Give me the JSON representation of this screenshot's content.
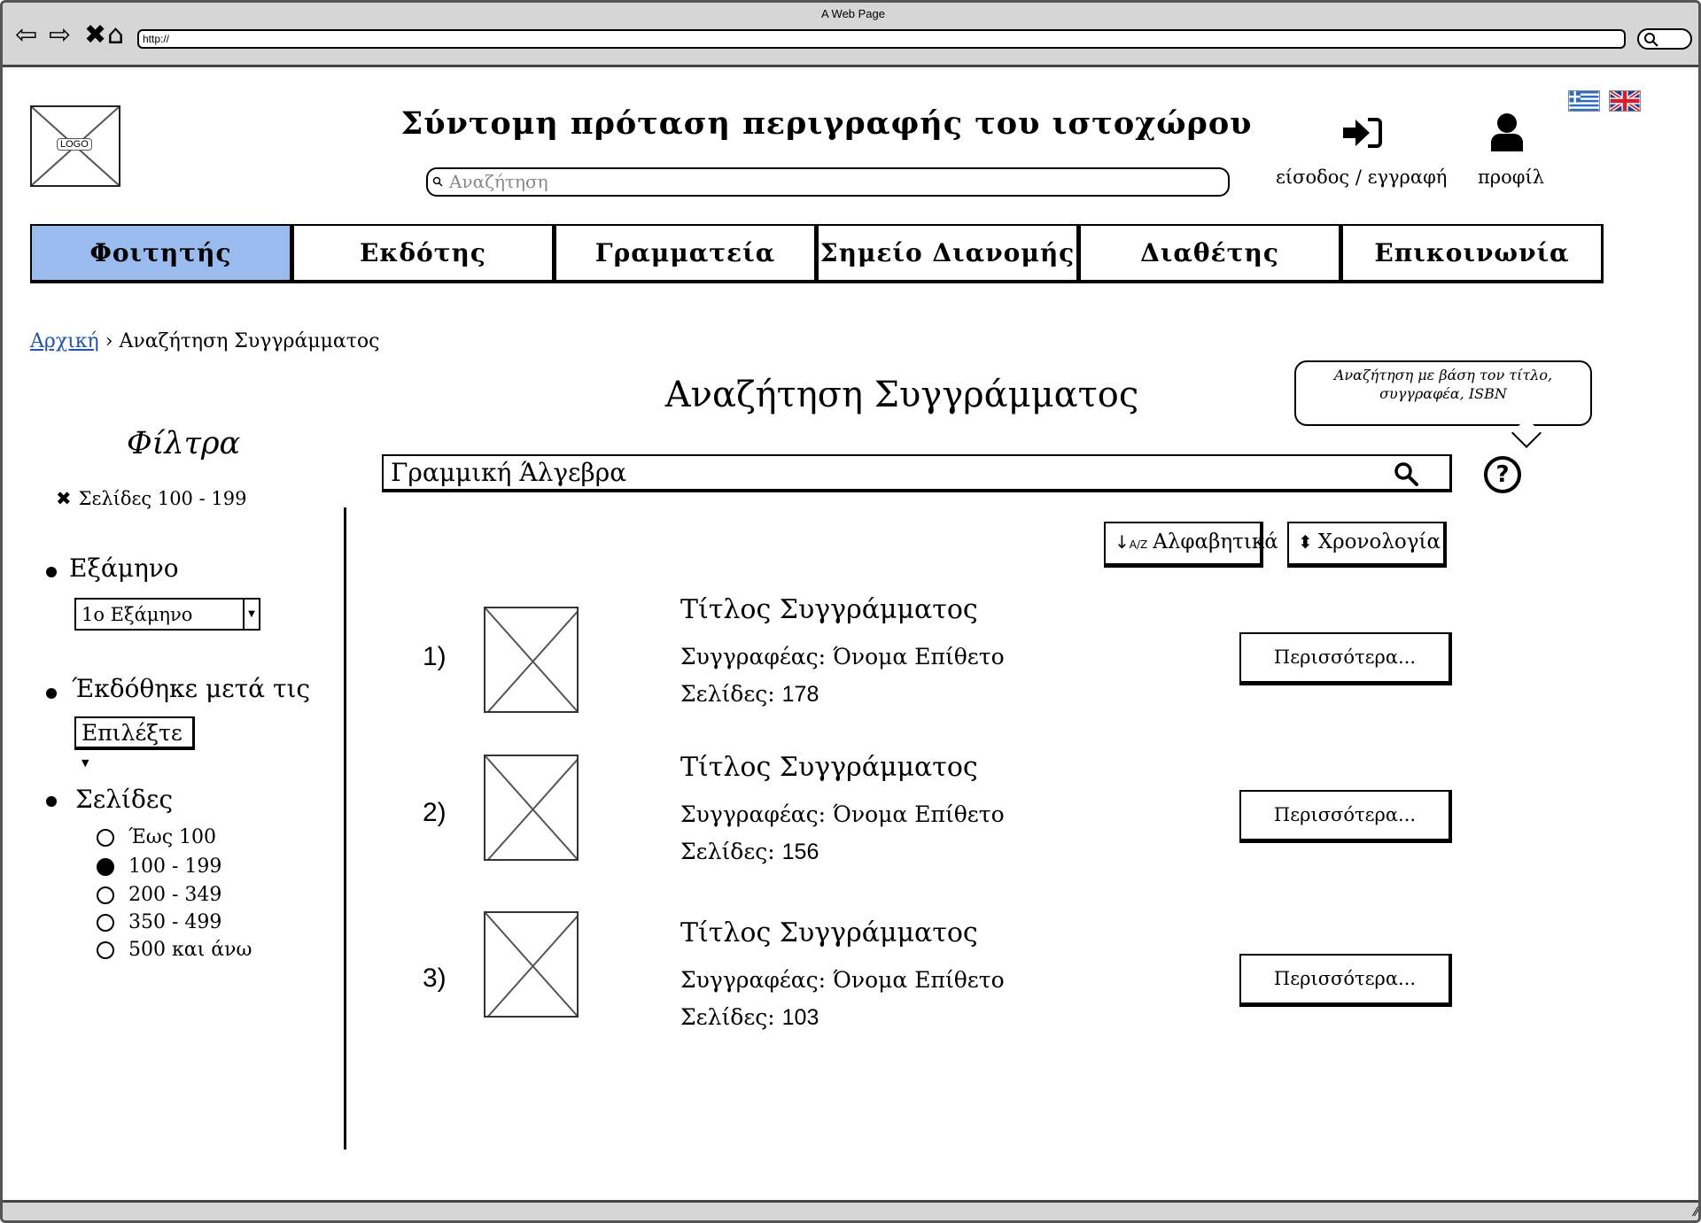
{
  "browser": {
    "window_title": "A Web Page",
    "url": "http://"
  },
  "header": {
    "logo_label": "LOGO",
    "site_description": "Σύντομη πρόταση περιγραφής του ιστοχώρου",
    "search_placeholder": "Αναζήτηση",
    "login_label": "είσοδος / εγγραφή",
    "profile_label": "προφίλ",
    "flags": [
      "greek-flag-icon",
      "uk-flag-icon"
    ]
  },
  "menu": {
    "items": [
      {
        "label": "Φοιτητής",
        "active": true
      },
      {
        "label": "Εκδότης",
        "active": false
      },
      {
        "label": "Γραμματεία",
        "active": false
      },
      {
        "label": "Σημείο Διανομής",
        "active": false
      },
      {
        "label": "Διαθέτης",
        "active": false
      },
      {
        "label": "Επικοινωνία",
        "active": false
      }
    ],
    "active_color": "#99bbee"
  },
  "breadcrumb": {
    "home": "Αρχική",
    "separator": "›",
    "current": "Αναζήτηση Συγγράμματος"
  },
  "filters": {
    "title": "Φίλτρα",
    "active_filter": "Σελίδες 100 - 199",
    "semester": {
      "label": "Εξάμηνο",
      "selected": "1ο Εξάμηνο"
    },
    "published_after": {
      "label": "Έκδόθηκε μετά τις",
      "button": "Επιλέξτε"
    },
    "pages": {
      "label": "Σελίδες",
      "options": [
        {
          "label": "Έως 100",
          "selected": false
        },
        {
          "label": "100 - 199",
          "selected": true
        },
        {
          "label": "200 - 349",
          "selected": false
        },
        {
          "label": "350 - 499",
          "selected": false
        },
        {
          "label": "500 και άνω",
          "selected": false
        }
      ]
    }
  },
  "main": {
    "title": "Αναζήτηση Συγγράμματος",
    "tooltip": "Αναζήτηση με βάση τον τίτλο, συγγραφέα, ISBN",
    "search_value": "Γραμμική Άλγεβρα",
    "sort": {
      "alphabetical": "Αλφαβητικά",
      "chronological": "Χρονολογία"
    },
    "results": [
      {
        "num": "1)",
        "title": "Τίτλος Συγγράμματος",
        "author": "Συγγραφέας: Όνομα Επίθετο",
        "pages_label": "Σελίδες:",
        "pages": "178",
        "more": "Περισσότερα..."
      },
      {
        "num": "2)",
        "title": "Τίτλος Συγγράμματος",
        "author": "Συγγραφέας: Όνομα Επίθετο",
        "pages_label": "Σελίδες:",
        "pages": "156",
        "more": "Περισσότερα..."
      },
      {
        "num": "3)",
        "title": "Τίτλος Συγγράμματος",
        "author": "Συγγραφέας: Όνομα Επίθετο",
        "pages_label": "Σελίδες:",
        "pages": "103",
        "more": "Περισσότερα..."
      }
    ]
  }
}
